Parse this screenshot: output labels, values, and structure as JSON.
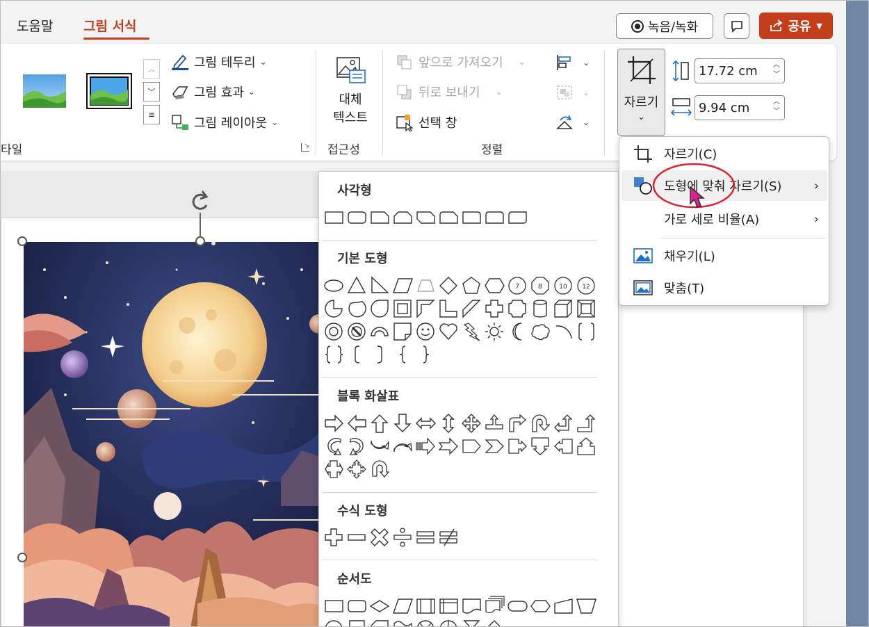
{
  "tabs": [
    {
      "label": "도움말"
    },
    {
      "label": "그림 서식",
      "active": true
    }
  ],
  "top_buttons": {
    "record": "녹음/녹화",
    "share": "공유"
  },
  "ribbon": {
    "styles_group_label": "타일",
    "picture_border": "그림 테두리",
    "picture_effects": "그림 효과",
    "picture_layout": "그림 레이아웃",
    "alt_text_line1": "대체",
    "alt_text_line2": "텍스트",
    "accessibility_label": "접근성",
    "bring_forward": "앞으로 가져오기",
    "send_backward": "뒤로 보내기",
    "selection_pane": "선택 창",
    "arrange_label": "정렬",
    "crop_label": "자르기",
    "height_value": "17.72 cm",
    "width_value": "9.94 cm"
  },
  "crop_menu": {
    "items": [
      {
        "label": "자르기(C)",
        "icon": "crop-icon"
      },
      {
        "label": "도형에 맞춰 자르기(S)",
        "icon": "crop-to-shape-icon",
        "submenu": true,
        "hovered": true
      },
      {
        "label": "가로 세로 비율(A)",
        "icon": "",
        "submenu": true
      },
      {
        "label": "채우기(L)",
        "icon": "fill-picture-icon"
      },
      {
        "label": "맞춤(T)",
        "icon": "fit-picture-icon"
      }
    ]
  },
  "shapes_gallery": {
    "sections": [
      {
        "title": "사각형"
      },
      {
        "title": "기본 도형"
      },
      {
        "title": "블록 화살표"
      },
      {
        "title": "수식 도형"
      },
      {
        "title": "순서도"
      }
    ]
  },
  "colors": {
    "accent": "#c43e1c",
    "highlight_circle": "#e0202a",
    "cursor": "#e0208c"
  }
}
